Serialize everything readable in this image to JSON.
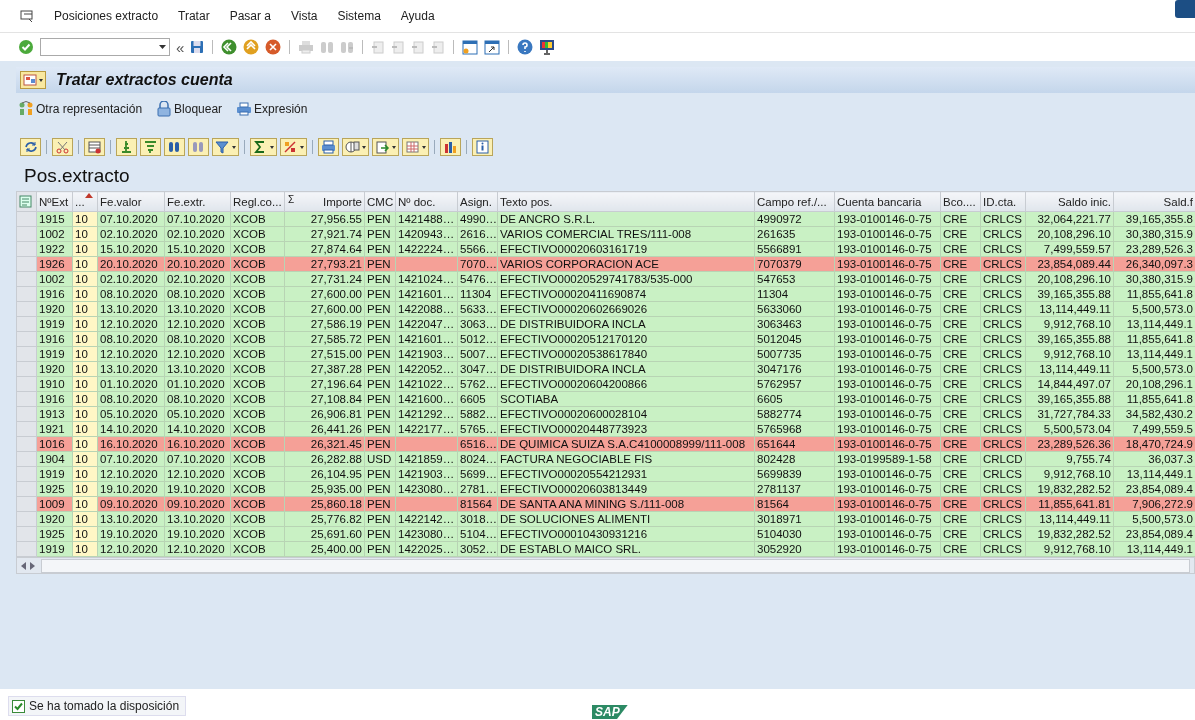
{
  "menu_bar": {
    "items": [
      "Posiciones extracto",
      "Tratar",
      "Pasar a",
      "Vista",
      "Sistema",
      "Ayuda"
    ]
  },
  "standard_toolbar": {
    "back_glyph": "«"
  },
  "title_bar": {
    "title": "Tratar extractos cuenta"
  },
  "application_toolbar": {
    "buttons": [
      "Otra representación",
      "Bloquear",
      "Expresión"
    ]
  },
  "grid": {
    "title": "Pos.extracto",
    "columns": [
      {
        "label": "NºExt"
      },
      {
        "label": "...",
        "sorted": true
      },
      {
        "label": "Fe.valor"
      },
      {
        "label": "Fe.extr."
      },
      {
        "label": "Regl.co..."
      },
      {
        "label": "Importe",
        "icon": "Σ"
      },
      {
        "label": "CMC"
      },
      {
        "label": "Nº doc."
      },
      {
        "label": "Asign."
      },
      {
        "label": "Texto pos."
      },
      {
        "label": "Campo ref./..."
      },
      {
        "label": "Cuenta bancaria"
      },
      {
        "label": "Bco...."
      },
      {
        "label": "ID.cta."
      },
      {
        "label": "Saldo inic."
      },
      {
        "label": "Sald.f"
      }
    ],
    "rows": [
      {
        "color": "#c9f1c4",
        "cells": [
          "1915",
          "10",
          "07.10.2020",
          "07.10.2020",
          "XCOB",
          "27,956.55",
          "PEN",
          "1421488…",
          "4990…",
          "DE ANCRO S.R.L.",
          "4990972",
          "193-0100146-0-75",
          "CRE",
          "CRLCS",
          "32,064,221.77",
          "39,165,355.8"
        ]
      },
      {
        "color": "#c9f1c4",
        "cells": [
          "1002",
          "10",
          "02.10.2020",
          "02.10.2020",
          "XCOB",
          "27,921.74",
          "PEN",
          "1420943…",
          "2616…",
          "VARIOS COMERCIAL TRES/111-008",
          "261635",
          "193-0100146-0-75",
          "CRE",
          "CRLCS",
          "20,108,296.10",
          "30,380,315.9"
        ]
      },
      {
        "color": "#c9f1c4",
        "cells": [
          "1922",
          "10",
          "15.10.2020",
          "15.10.2020",
          "XCOB",
          "27,874.64",
          "PEN",
          "1422224…",
          "5566…",
          "EFECTIVO00020603161719",
          "5566891",
          "193-0100146-0-75",
          "CRE",
          "CRLCS",
          "7,499,559.57",
          "23,289,526.3"
        ]
      },
      {
        "color": "#f5a097",
        "cells": [
          "1926",
          "10",
          "20.10.2020",
          "20.10.2020",
          "XCOB",
          "27,793.21",
          "PEN",
          null,
          "7070…",
          "VARIOS CORPORACION ACE",
          "7070379",
          "193-0100146-0-75",
          "CRE",
          "CRLCS",
          "23,854,089.44",
          "26,340,097.3"
        ]
      },
      {
        "color": "#c9f1c4",
        "cells": [
          "1002",
          "10",
          "02.10.2020",
          "02.10.2020",
          "XCOB",
          "27,731.24",
          "PEN",
          "1421024…",
          "5476…",
          "EFECTIVO00020529741783/535-000",
          "547653",
          "193-0100146-0-75",
          "CRE",
          "CRLCS",
          "20,108,296.10",
          "30,380,315.9"
        ]
      },
      {
        "color": "#c9f1c4",
        "cells": [
          "1916",
          "10",
          "08.10.2020",
          "08.10.2020",
          "XCOB",
          "27,600.00",
          "PEN",
          "1421601…",
          "11304",
          "EFECTIVO00020411690874",
          "11304",
          "193-0100146-0-75",
          "CRE",
          "CRLCS",
          "39,165,355.88",
          "11,855,641.8"
        ]
      },
      {
        "color": "#c9f1c4",
        "cells": [
          "1920",
          "10",
          "13.10.2020",
          "13.10.2020",
          "XCOB",
          "27,600.00",
          "PEN",
          "1422088…",
          "5633…",
          "EFECTIVO00020602669026",
          "5633060",
          "193-0100146-0-75",
          "CRE",
          "CRLCS",
          "13,114,449.11",
          "5,500,573.0"
        ]
      },
      {
        "color": "#c9f1c4",
        "cells": [
          "1919",
          "10",
          "12.10.2020",
          "12.10.2020",
          "XCOB",
          "27,586.19",
          "PEN",
          "1422047…",
          "3063…",
          "DE DISTRIBUIDORA INCLA",
          "3063463",
          "193-0100146-0-75",
          "CRE",
          "CRLCS",
          "9,912,768.10",
          "13,114,449.1"
        ]
      },
      {
        "color": "#c9f1c4",
        "cells": [
          "1916",
          "10",
          "08.10.2020",
          "08.10.2020",
          "XCOB",
          "27,585.72",
          "PEN",
          "1421601…",
          "5012…",
          "EFECTIVO00020512170120",
          "5012045",
          "193-0100146-0-75",
          "CRE",
          "CRLCS",
          "39,165,355.88",
          "11,855,641.8"
        ]
      },
      {
        "color": "#c9f1c4",
        "cells": [
          "1919",
          "10",
          "12.10.2020",
          "12.10.2020",
          "XCOB",
          "27,515.00",
          "PEN",
          "1421903…",
          "5007…",
          "EFECTIVO00020538617840",
          "5007735",
          "193-0100146-0-75",
          "CRE",
          "CRLCS",
          "9,912,768.10",
          "13,114,449.1"
        ]
      },
      {
        "color": "#c9f1c4",
        "cells": [
          "1920",
          "10",
          "13.10.2020",
          "13.10.2020",
          "XCOB",
          "27,387.28",
          "PEN",
          "1422052…",
          "3047…",
          "DE DISTRIBUIDORA INCLA",
          "3047176",
          "193-0100146-0-75",
          "CRE",
          "CRLCS",
          "13,114,449.11",
          "5,500,573.0"
        ]
      },
      {
        "color": "#c9f1c4",
        "cells": [
          "1910",
          "10",
          "01.10.2020",
          "01.10.2020",
          "XCOB",
          "27,196.64",
          "PEN",
          "1421022…",
          "5762…",
          "EFECTIVO00020604200866",
          "5762957",
          "193-0100146-0-75",
          "CRE",
          "CRLCS",
          "14,844,497.07",
          "20,108,296.1"
        ]
      },
      {
        "color": "#c9f1c4",
        "cells": [
          "1916",
          "10",
          "08.10.2020",
          "08.10.2020",
          "XCOB",
          "27,108.84",
          "PEN",
          "1421600…",
          "6605",
          "SCOTIABA",
          "6605",
          "193-0100146-0-75",
          "CRE",
          "CRLCS",
          "39,165,355.88",
          "11,855,641.8"
        ]
      },
      {
        "color": "#c9f1c4",
        "cells": [
          "1913",
          "10",
          "05.10.2020",
          "05.10.2020",
          "XCOB",
          "26,906.81",
          "PEN",
          "1421292…",
          "5882…",
          "EFECTIVO00020600028104",
          "5882774",
          "193-0100146-0-75",
          "CRE",
          "CRLCS",
          "31,727,784.33",
          "34,582,430.2"
        ]
      },
      {
        "color": "#c9f1c4",
        "cells": [
          "1921",
          "10",
          "14.10.2020",
          "14.10.2020",
          "XCOB",
          "26,441.26",
          "PEN",
          "1422177…",
          "5765…",
          "EFECTIVO00020448773923",
          "5765968",
          "193-0100146-0-75",
          "CRE",
          "CRLCS",
          "5,500,573.04",
          "7,499,559.5"
        ]
      },
      {
        "color": "#f5a097",
        "cells": [
          "1016",
          "10",
          "16.10.2020",
          "16.10.2020",
          "XCOB",
          "26,321.45",
          "PEN",
          null,
          "6516…",
          "DE QUIMICA SUIZA S.A.C4100008999/111-008",
          "651644",
          "193-0100146-0-75",
          "CRE",
          "CRLCS",
          "23,289,526.36",
          "18,470,724.9"
        ]
      },
      {
        "color": "#c9f1c4",
        "cells": [
          "1904",
          "10",
          "07.10.2020",
          "07.10.2020",
          "XCOB",
          "26,282.88",
          "USD",
          "1421859…",
          "8024…",
          "FACTURA NEGOCIABLE FIS",
          "802428",
          "193-0199589-1-58",
          "CRE",
          "CRLCD",
          "9,755.74",
          "36,037.3"
        ]
      },
      {
        "color": "#c9f1c4",
        "cells": [
          "1919",
          "10",
          "12.10.2020",
          "12.10.2020",
          "XCOB",
          "26,104.95",
          "PEN",
          "1421903…",
          "5699…",
          "EFECTIVO00020554212931",
          "5699839",
          "193-0100146-0-75",
          "CRE",
          "CRLCS",
          "9,912,768.10",
          "13,114,449.1"
        ]
      },
      {
        "color": "#c9f1c4",
        "cells": [
          "1925",
          "10",
          "19.10.2020",
          "19.10.2020",
          "XCOB",
          "25,935.00",
          "PEN",
          "1423080…",
          "2781…",
          "EFECTIVO00020603813449",
          "2781137",
          "193-0100146-0-75",
          "CRE",
          "CRLCS",
          "19,832,282.52",
          "23,854,089.4"
        ]
      },
      {
        "color": "#f5a097",
        "cells": [
          "1009",
          "10",
          "09.10.2020",
          "09.10.2020",
          "XCOB",
          "25,860.18",
          "PEN",
          null,
          "81564",
          "DE SANTA ANA MINING S./111-008",
          "81564",
          "193-0100146-0-75",
          "CRE",
          "CRLCS",
          "11,855,641.81",
          "7,906,272.9"
        ]
      },
      {
        "color": "#c9f1c4",
        "cells": [
          "1920",
          "10",
          "13.10.2020",
          "13.10.2020",
          "XCOB",
          "25,776.82",
          "PEN",
          "1422142…",
          "3018…",
          "DE SOLUCIONES ALIMENTI",
          "3018971",
          "193-0100146-0-75",
          "CRE",
          "CRLCS",
          "13,114,449.11",
          "5,500,573.0"
        ]
      },
      {
        "color": "#c9f1c4",
        "cells": [
          "1925",
          "10",
          "19.10.2020",
          "19.10.2020",
          "XCOB",
          "25,691.60",
          "PEN",
          "1423080…",
          "5104…",
          "EFECTIVO00010430931216",
          "5104030",
          "193-0100146-0-75",
          "CRE",
          "CRLCS",
          "19,832,282.52",
          "23,854,089.4"
        ]
      },
      {
        "color": "#c9f1c4",
        "cells": [
          "1919",
          "10",
          "12.10.2020",
          "12.10.2020",
          "XCOB",
          "25,400.00",
          "PEN",
          "1422025…",
          "3052…",
          "DE ESTABLO MAICO SRL.",
          "3052920",
          "193-0100146-0-75",
          "CRE",
          "CRLCS",
          "9,912,768.10",
          "13,114,449.1"
        ]
      }
    ]
  },
  "status_bar": {
    "message": "Se ha tomado la disposición",
    "logo": "SAP"
  }
}
